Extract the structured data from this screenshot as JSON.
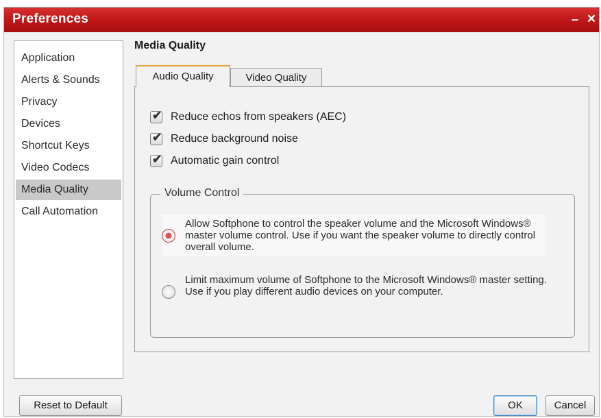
{
  "window": {
    "title": "Preferences",
    "minimize_glyph": "–",
    "close_glyph": "✕",
    "accent_color": "#c01818"
  },
  "sidebar": {
    "items": [
      {
        "label": "Application"
      },
      {
        "label": "Alerts & Sounds"
      },
      {
        "label": "Privacy"
      },
      {
        "label": "Devices"
      },
      {
        "label": "Shortcut Keys"
      },
      {
        "label": "Video Codecs"
      },
      {
        "label": "Media Quality",
        "selected": true
      },
      {
        "label": "Call Automation"
      }
    ]
  },
  "main": {
    "section_title": "Media Quality",
    "tabs": [
      {
        "label": "Audio Quality",
        "active": true
      },
      {
        "label": "Video Quality",
        "active": false
      }
    ],
    "checkboxes": [
      {
        "label": "Reduce echos from speakers (AEC)",
        "checked": true
      },
      {
        "label": "Reduce background noise",
        "checked": true
      },
      {
        "label": "Automatic gain control",
        "checked": true
      }
    ],
    "volume_control": {
      "legend": "Volume Control",
      "options": [
        {
          "label": "Allow Softphone to control the speaker volume and the Microsoft Windows® master volume control. Use if you want the speaker volume to directly control overall volume.",
          "selected": true
        },
        {
          "label": "Limit maximum volume of Softphone to the Microsoft Windows® master setting. Use if you play different audio devices on your computer.",
          "selected": false
        }
      ]
    }
  },
  "footer": {
    "reset_label": "Reset to Default",
    "ok_label": "OK",
    "cancel_label": "Cancel"
  }
}
